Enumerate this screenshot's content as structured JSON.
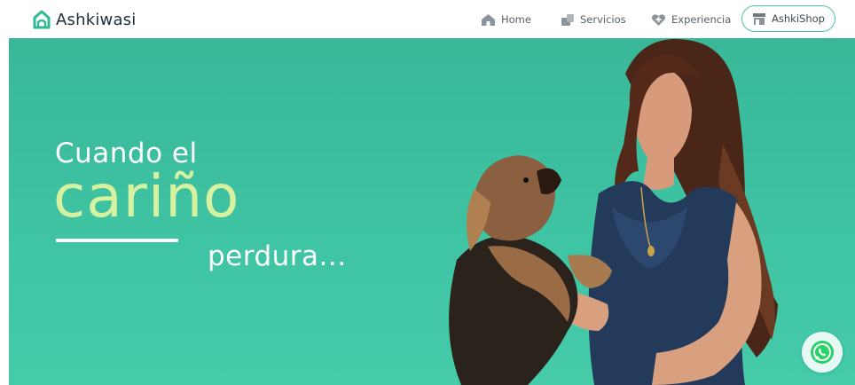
{
  "brand": {
    "name": "Ashkiwasi",
    "icon": "house-logo-icon",
    "accent": "#2fb893"
  },
  "nav": {
    "items": [
      {
        "label": "Home",
        "icon": "house-icon"
      },
      {
        "label": "Servicios",
        "icon": "services-icon"
      },
      {
        "label": "Experiencia",
        "icon": "heart-plus-icon"
      }
    ],
    "shop": {
      "label": "AshkiShop",
      "icon": "store-icon",
      "border_color": "#46c6a6"
    }
  },
  "hero": {
    "line1": "Cuando el",
    "line2": "cariño",
    "line3": "perdura...",
    "background": "#3fc4a4",
    "highlight_color": "#d6f1a0",
    "image": "woman-holding-yorkshire-terrier-photo"
  },
  "whatsapp": {
    "icon": "whatsapp-icon",
    "color": "#25d366"
  }
}
